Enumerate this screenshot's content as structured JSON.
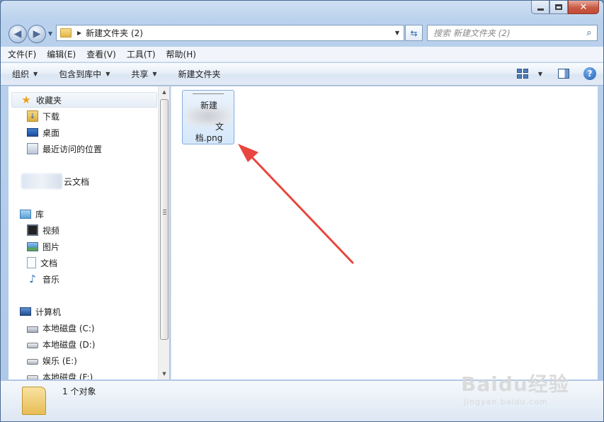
{
  "window": {
    "caption": {
      "minimize": "—",
      "maximize": "□",
      "close": "✕"
    }
  },
  "address": {
    "path": "新建文件夹 (2)",
    "search_placeholder": "搜索 新建文件夹 (2)"
  },
  "menubar": [
    "文件(F)",
    "编辑(E)",
    "查看(V)",
    "工具(T)",
    "帮助(H)"
  ],
  "toolbar": {
    "organize": "组织",
    "include_library": "包含到库中",
    "share": "共享",
    "new_folder": "新建文件夹"
  },
  "nav": {
    "favorites": "收藏夹",
    "downloads": "下载",
    "desktop": "桌面",
    "recent": "最近访问的位置",
    "cloud_docs": "云文档",
    "libraries": "库",
    "videos": "视频",
    "pictures": "图片",
    "documents": "文档",
    "music": "音乐",
    "computer": "计算机",
    "drive_c": "本地磁盘 (C:)",
    "drive_d": "本地磁盘 (D:)",
    "drive_e": "娱乐 (E:)",
    "drive_f": "本地磁盘 (F:)"
  },
  "file": {
    "line1": "新建",
    "line3": "文",
    "line4": "档.png"
  },
  "status": {
    "count": "1 个对象"
  },
  "watermark": {
    "brand": "Baidu经验",
    "url": "jingyan.baidu.com"
  },
  "colors": {
    "annotation_arrow": "#e8463f",
    "selection": "#d6e8fb"
  }
}
